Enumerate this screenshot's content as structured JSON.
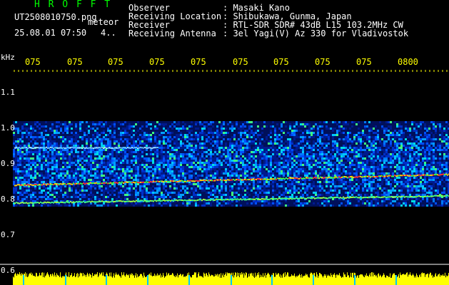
{
  "header": {
    "app_title": "H R O F F T",
    "filename": "UT2508010750.png",
    "mode": "meteor",
    "datetime": "25.08.01 07:50",
    "page": "4..",
    "info_labels": [
      "Observer",
      "Receiving Location",
      "Receiver",
      "Receiving Antenna"
    ],
    "info_values": [
      ": Masaki Kano",
      ": Shibukawa, Gunma, Japan",
      ": RTL-SDR SDR# 43dB L15 103.2MHz CW",
      ": 3el Yagi(V) Az 330 for Vladivostok"
    ]
  },
  "colors": {
    "title_green": "#00ff00",
    "header_white": "#ffffff",
    "axis_yellow": "#ffff00",
    "background": "#000000",
    "cyan_tick": "#00c8ff"
  },
  "chart_data": {
    "type": "heatmap",
    "yunit": "kHz",
    "y_ticks": [
      "1.1",
      "1.0",
      "0.9",
      "0.8",
      "0.7",
      "0.6"
    ],
    "y_tick_values": [
      1.1,
      1.0,
      0.9,
      0.8,
      0.7,
      0.6
    ],
    "ylim": [
      0.6,
      1.1
    ],
    "x_tick_labels": [
      "075",
      "075",
      "075",
      "075",
      "075",
      "075",
      "075",
      "075",
      "075",
      "0800"
    ],
    "signal_band_khz": [
      0.78,
      1.02
    ],
    "carrier_lines": [
      {
        "start_khz": 0.84,
        "end_khz": 0.87
      },
      {
        "start_khz": 0.79,
        "end_khz": 0.81
      },
      {
        "start_khz": 0.945,
        "end_khz": 0.945
      }
    ]
  }
}
